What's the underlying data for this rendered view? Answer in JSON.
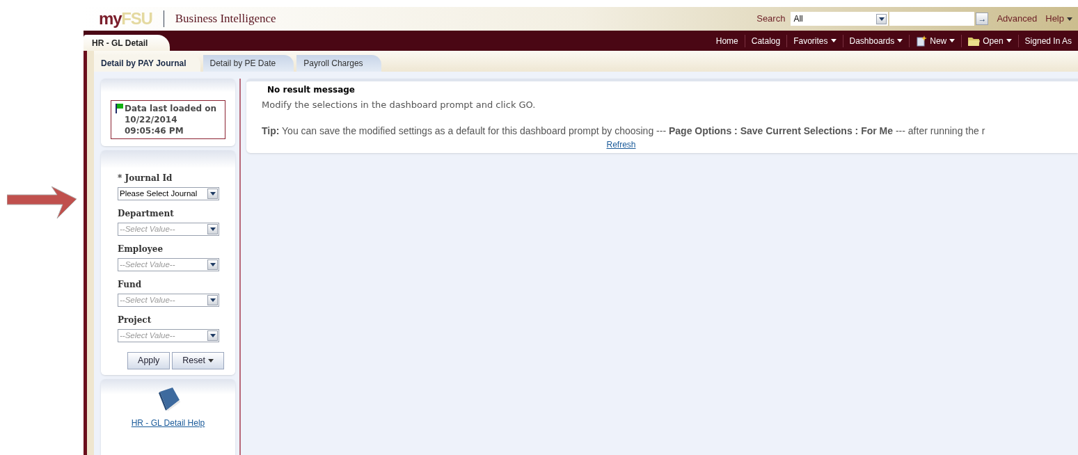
{
  "logo": {
    "part_1": "my",
    "part_2": "FSU"
  },
  "app_title": "Business Intelligence",
  "search": {
    "label": "Search",
    "scope": "All",
    "go": "→"
  },
  "top_links": [
    {
      "label": "Advanced",
      "caret": false
    },
    {
      "label": "Help",
      "caret": true
    }
  ],
  "nav": [
    {
      "label": "Home",
      "caret": false,
      "kind": "plain"
    },
    {
      "label": "Catalog",
      "caret": false,
      "kind": "plain"
    },
    {
      "label": "Favorites",
      "caret": true,
      "kind": "plain"
    },
    {
      "label": "Dashboards",
      "caret": true,
      "kind": "plain"
    },
    {
      "label": "New",
      "caret": true,
      "kind": "new"
    },
    {
      "label": "Open",
      "caret": true,
      "kind": "folder"
    },
    {
      "label": "Signed In As",
      "caret": false,
      "kind": "plain"
    }
  ],
  "dashboard_title": "HR - GL Detail",
  "tabs": [
    {
      "label": "Detail by PAY Journal",
      "selected": true
    },
    {
      "label": "Detail by PE Date",
      "selected": false
    },
    {
      "label": "Payroll Charges",
      "selected": false
    }
  ],
  "data_status": {
    "lines": [
      "Data last loaded on",
      "10/22/2014",
      "09:05:46 PM"
    ]
  },
  "prompts": [
    {
      "label": "Journal Id",
      "required": true,
      "value": "Please Select Journal"
    },
    {
      "label": "Department",
      "required": false,
      "placeholder": "--Select Value--"
    },
    {
      "label": "Employee",
      "required": false,
      "placeholder": "--Select Value--"
    },
    {
      "label": "Fund",
      "required": false,
      "placeholder": "--Select Value--"
    },
    {
      "label": "Project",
      "required": false,
      "placeholder": "--Select Value--"
    }
  ],
  "required_mark": "*",
  "buttons": [
    {
      "label": "Apply",
      "caret": false
    },
    {
      "label": "Reset",
      "caret": true
    }
  ],
  "help_link": "HR - GL Detail Help",
  "result": {
    "title": "No result message",
    "message": "Modify the selections in the dashboard prompt and click GO.",
    "tip": "**Tip:** You can save the modified settings as a default for this dashboard prompt by choosing --- **Page Options : Save Current Selections : For Me** --- after running the r",
    "refresh": "Refresh"
  }
}
